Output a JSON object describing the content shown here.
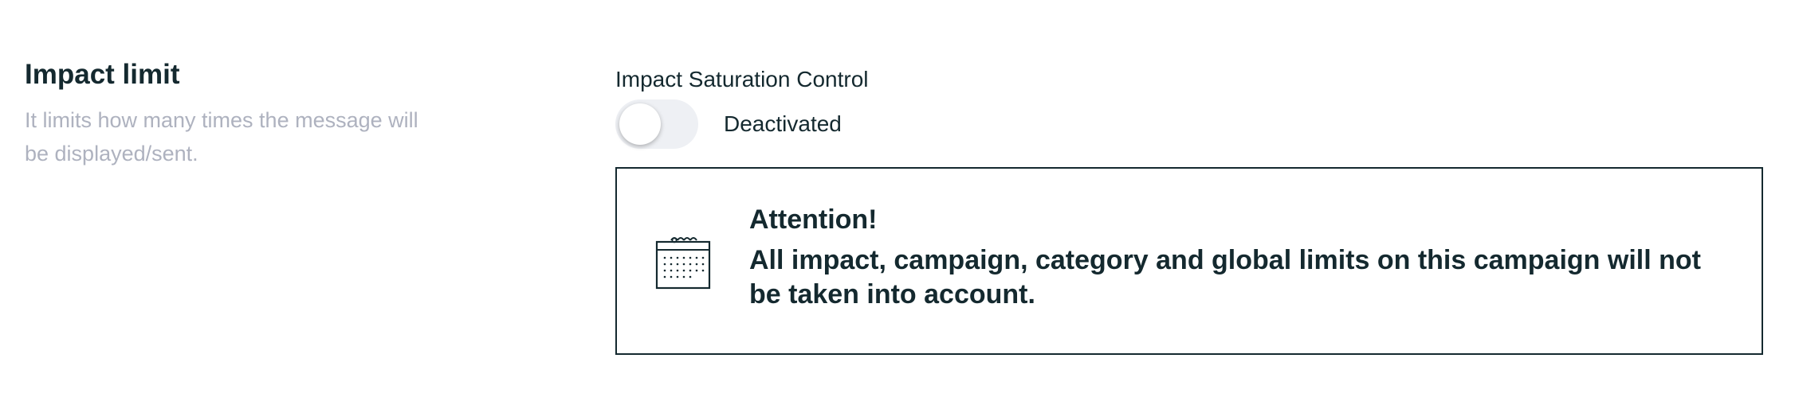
{
  "impact_limit": {
    "title": "Impact limit",
    "description": "It limits how many times the message will be displayed/sent."
  },
  "saturation_control": {
    "label": "Impact Saturation Control",
    "toggle_state": "off",
    "status_text": "Deactivated"
  },
  "alert": {
    "icon": "calendar-icon",
    "title": "Attention!",
    "message": "All impact, campaign, category and global limits on this campaign will not be taken into account."
  },
  "colors": {
    "text_primary": "#14292f",
    "text_muted": "#aeb2bf",
    "toggle_track": "#eef0f4"
  }
}
